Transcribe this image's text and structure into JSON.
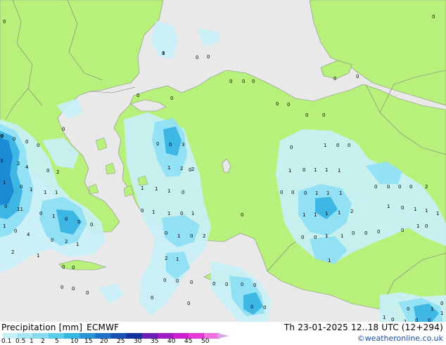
{
  "title": {
    "variable": "Precipitation [mm]",
    "model": "ECMWF",
    "valid_time": "Th 23-01-2025 12..18 UTC (12+294)",
    "credit": "©weatheronline.co.uk"
  },
  "legend": {
    "ticks": [
      "0.1",
      "0.5",
      "1",
      "2",
      "5",
      "10",
      "15",
      "20",
      "25",
      "30",
      "35",
      "40",
      "45",
      "50"
    ],
    "colors": [
      "#c6f0f6",
      "#a6e6f2",
      "#86dcee",
      "#5ccde8",
      "#36b9e0",
      "#2a96d6",
      "#1f72c8",
      "#1a4fb4",
      "#14309c",
      "#6a1fb6",
      "#a21cc6",
      "#cc20d0",
      "#e43ad8",
      "#f070e0"
    ]
  },
  "colors": {
    "land": "#b8f07c",
    "sea": "#e9e9e9",
    "precip_light": "#c8f0f8",
    "precip_medium": "#90e0f4",
    "precip_heavy": "#3ab4e4",
    "precip_heaviest": "#1888d4"
  },
  "map_values": [
    "0",
    "1",
    "0",
    "0",
    "0",
    "0",
    "0",
    "0",
    "0",
    "0",
    "0",
    "0",
    "0",
    "0",
    "0",
    "0",
    "0",
    "0",
    "0",
    "0",
    "0",
    "0",
    "0",
    "3",
    "2",
    "4",
    "0",
    "0",
    "3",
    "0",
    "1",
    "2",
    "2",
    "0",
    "2",
    "1",
    "0",
    "1",
    "1",
    "1",
    "0",
    "11",
    "1",
    "0",
    "4",
    "0",
    "1",
    "0",
    "0",
    "0",
    "0",
    "2",
    "1",
    "2",
    "1",
    "0",
    "0",
    "1",
    "1",
    "1",
    "0",
    "0",
    "1",
    "1",
    "0",
    "1",
    "0",
    "1",
    "0",
    "2",
    "2",
    "1",
    "0",
    "0",
    "0",
    "0",
    "0",
    "0",
    "0",
    "0",
    "0",
    "0",
    "0",
    "0",
    "0",
    "0",
    "0",
    "1",
    "0",
    "0",
    "1",
    "0",
    "1",
    "1",
    "1",
    "0",
    "0",
    "0",
    "1",
    "1",
    "1",
    "0",
    "1",
    "1",
    "1",
    "1",
    "2",
    "0",
    "0",
    "1",
    "1",
    "0",
    "0",
    "0",
    "1",
    "0",
    "0",
    "0",
    "0",
    "0",
    "2",
    "1",
    "0",
    "1",
    "1",
    "1",
    "1",
    "0",
    "1",
    "0",
    "0",
    "1",
    "1",
    "0",
    "1",
    "0",
    "0",
    "4",
    "1",
    "0",
    "1",
    "1",
    "1",
    "0",
    "1"
  ]
}
